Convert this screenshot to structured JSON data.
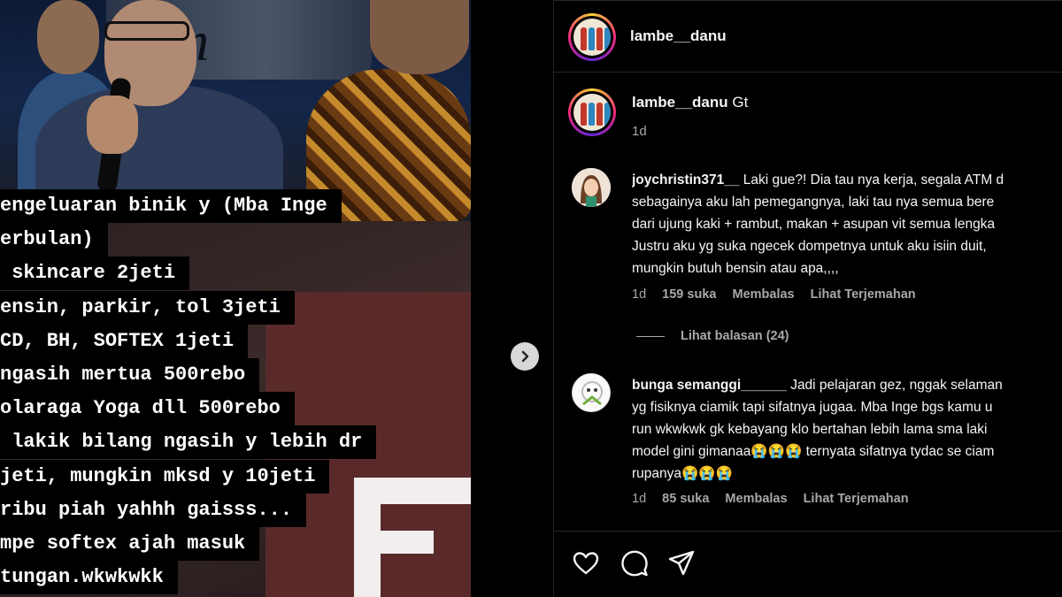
{
  "media": {
    "caption_lines": [
      "engeluaran binik y (Mba Inge",
      "erbulan)",
      " skincare 2jeti",
      "ensin, parkir, tol 3jeti",
      "CD, BH, SOFTEX 1jeti",
      "ngasih mertua 500rebo",
      "olaraga Yoga dll 500rebo",
      " lakik bilang ngasih y lebih dr",
      "jeti, mungkin mksd y 10jeti",
      "ribu piah yahhh gaisss...",
      "mpe softex ajah masuk",
      "tungan.wkwkwkk"
    ]
  },
  "header": {
    "username": "lambe__danu"
  },
  "post": {
    "username": "lambe__danu",
    "caption": "Gt",
    "time": "1d"
  },
  "comments": [
    {
      "username": "joychristin371__",
      "lines": [
        "Laki gue?! Dia tau nya kerja, segala ATM d",
        "sebagainya aku lah pemegangnya, laki tau nya semua bere",
        "dari ujung kaki + rambut, makan + asupan vit semua lengka",
        "Justru aku yg suka ngecek dompetnya untuk aku isiin duit,",
        "mungkin butuh bensin atau apa,,,,"
      ],
      "time": "1d",
      "likes": "159 suka",
      "reply": "Membalas",
      "translate": "Lihat Terjemahan",
      "view_replies": "Lihat balasan (24)"
    },
    {
      "username": "bunga semanggi______",
      "lines": [
        "Jadi pelajaran gez, nggak selaman",
        "yg fisiknya ciamik tapi sifatnya jugaa. Mba Inge bgs kamu u",
        "run wkwkwk gk kebayang klo bertahan lebih lama sma laki",
        "model gini gimanaa😭😭😭 ternyata sifatnya tydac se ciam",
        "rupanya😭😭😭"
      ],
      "time": "1d",
      "likes": "85 suka",
      "reply": "Membalas",
      "translate": "Lihat Terjemahan"
    }
  ],
  "icons": {
    "like": "heart-icon",
    "comment": "comment-icon",
    "share": "send-icon",
    "next": "chevron-right-icon"
  }
}
